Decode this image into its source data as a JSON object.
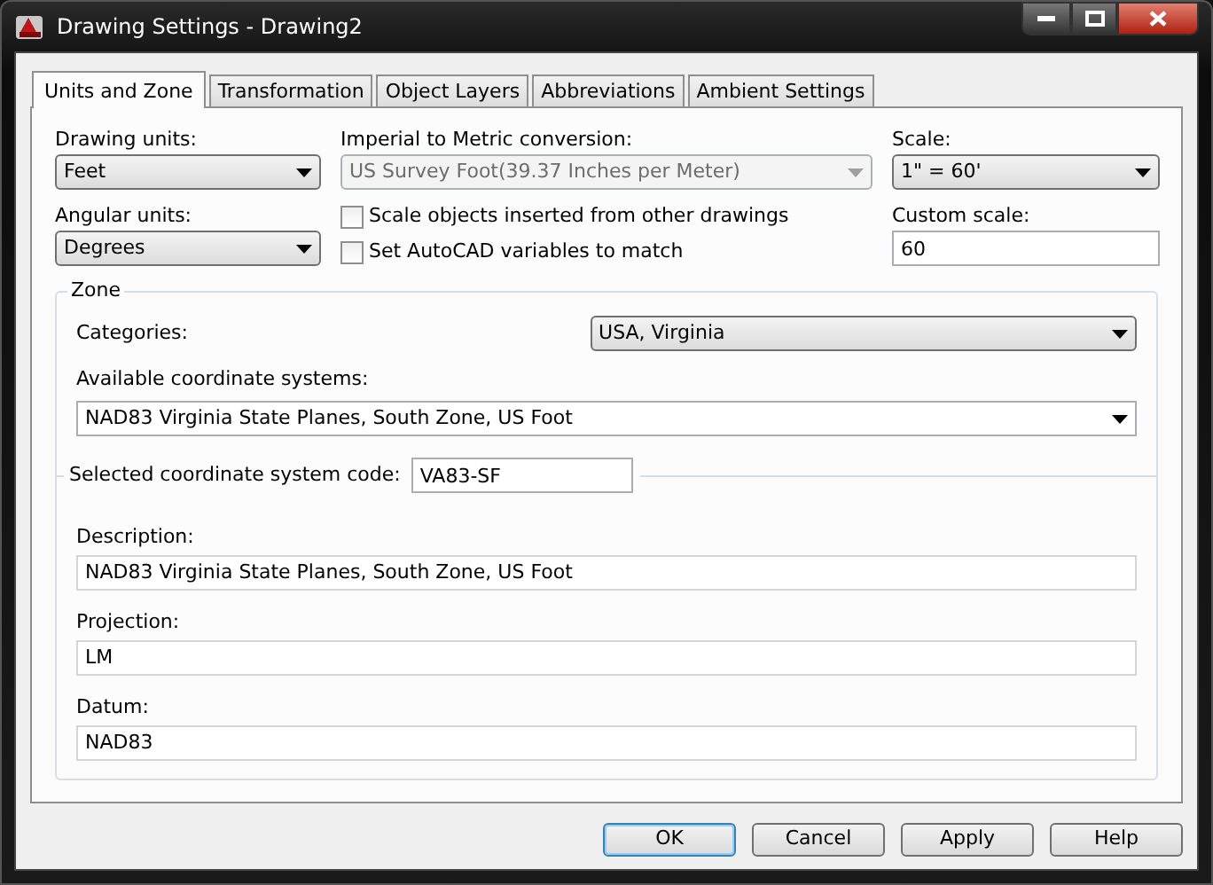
{
  "window": {
    "title": "Drawing Settings - Drawing2"
  },
  "tabs": [
    {
      "label": "Units and Zone",
      "selected": true
    },
    {
      "label": "Transformation",
      "selected": false
    },
    {
      "label": "Object Layers",
      "selected": false
    },
    {
      "label": "Abbreviations",
      "selected": false
    },
    {
      "label": "Ambient Settings",
      "selected": false
    }
  ],
  "units": {
    "drawing_units": {
      "label": "Drawing units:",
      "value": "Feet"
    },
    "conversion": {
      "label": "Imperial to Metric conversion:",
      "value": "US Survey Foot(39.37 Inches per Meter)",
      "disabled": true
    },
    "scale": {
      "label": "Scale:",
      "value": "1\" = 60'"
    },
    "angular_units": {
      "label": "Angular units:",
      "value": "Degrees"
    },
    "checkboxes": [
      {
        "label": "Scale objects inserted from other drawings",
        "checked": false
      },
      {
        "label": "Set AutoCAD variables to match",
        "checked": false
      }
    ],
    "custom_scale": {
      "label": "Custom scale:",
      "value": "60"
    }
  },
  "zone": {
    "title": "Zone",
    "categories": {
      "label": "Categories:",
      "value": "USA, Virginia"
    },
    "available": {
      "label": "Available coordinate systems:",
      "value": "NAD83 Virginia State Planes, South Zone, US Foot"
    },
    "code": {
      "label": "Selected coordinate system code:",
      "value": "VA83-SF"
    },
    "description": {
      "label": "Description:",
      "value": "NAD83 Virginia State Planes, South Zone, US Foot"
    },
    "projection": {
      "label": "Projection:",
      "value": "LM"
    },
    "datum": {
      "label": "Datum:",
      "value": "NAD83"
    }
  },
  "buttons": [
    {
      "label": "OK",
      "default": true
    },
    {
      "label": "Cancel",
      "default": false
    },
    {
      "label": "Apply",
      "default": false
    },
    {
      "label": "Help",
      "default": false
    }
  ]
}
